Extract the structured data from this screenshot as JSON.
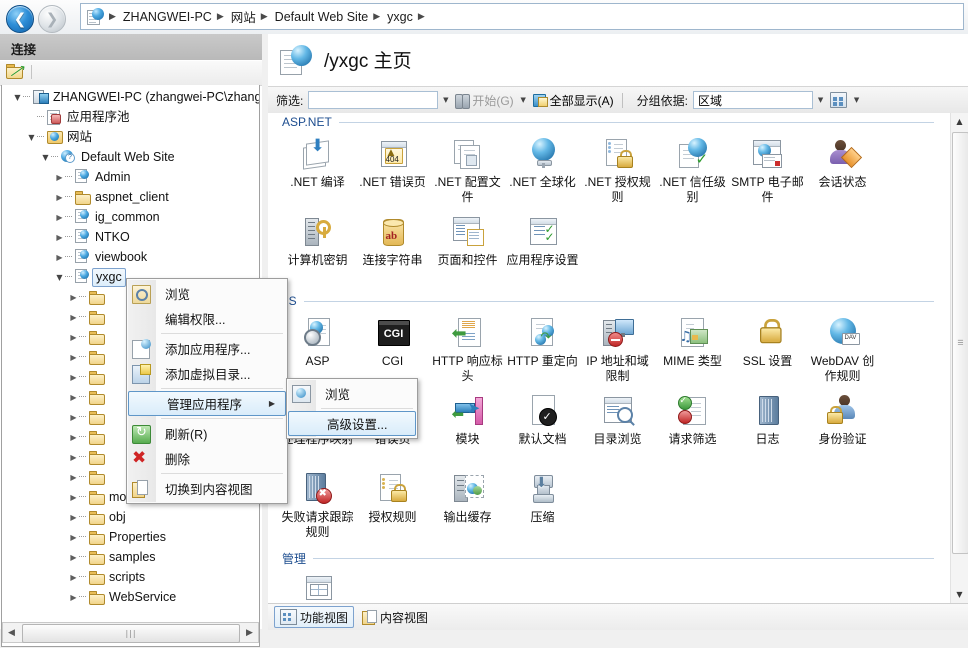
{
  "window": {
    "breadcrumb": [
      "ZHANGWEI-PC",
      "网站",
      "Default Web Site",
      "yxgc"
    ],
    "nav_back_label": "后退",
    "nav_forward_label": "前进"
  },
  "sidebar": {
    "header": "连接",
    "toolbar_icon": "connect-folder-icon",
    "tree": [
      {
        "label": "ZHANGWEI-PC (zhangwei-PC\\zhangw",
        "icon": "server-icon",
        "indent": 0,
        "expander": "open"
      },
      {
        "label": "应用程序池",
        "icon": "app-pool-icon",
        "indent": 1,
        "expander": "none"
      },
      {
        "label": "网站",
        "icon": "sites-folder-icon",
        "indent": 1,
        "expander": "open"
      },
      {
        "label": "Default Web Site",
        "icon": "web-site-icon",
        "indent": 2,
        "expander": "open"
      },
      {
        "label": "Admin",
        "icon": "application-icon",
        "indent": 3,
        "expander": "closed"
      },
      {
        "label": "aspnet_client",
        "icon": "folder-icon",
        "indent": 3,
        "expander": "closed"
      },
      {
        "label": "ig_common",
        "icon": "application-icon",
        "indent": 3,
        "expander": "closed"
      },
      {
        "label": "NTKO",
        "icon": "application-icon",
        "indent": 3,
        "expander": "closed"
      },
      {
        "label": "viewbook",
        "icon": "application-icon",
        "indent": 3,
        "expander": "closed"
      },
      {
        "label": "yxgc",
        "icon": "application-icon",
        "indent": 3,
        "expander": "open",
        "selected": true
      },
      {
        "label": "",
        "icon": "folder-icon",
        "indent": 4,
        "expander": "closed"
      },
      {
        "label": "",
        "icon": "folder-icon",
        "indent": 4,
        "expander": "closed"
      },
      {
        "label": "",
        "icon": "folder-icon",
        "indent": 4,
        "expander": "closed"
      },
      {
        "label": "",
        "icon": "folder-icon",
        "indent": 4,
        "expander": "closed"
      },
      {
        "label": "",
        "icon": "folder-icon",
        "indent": 4,
        "expander": "closed"
      },
      {
        "label": "",
        "icon": "folder-icon",
        "indent": 4,
        "expander": "closed"
      },
      {
        "label": "",
        "icon": "folder-icon",
        "indent": 4,
        "expander": "closed"
      },
      {
        "label": "",
        "icon": "folder-icon",
        "indent": 4,
        "expander": "closed"
      },
      {
        "label": "",
        "icon": "folder-icon",
        "indent": 4,
        "expander": "closed"
      },
      {
        "label": "",
        "icon": "folder-icon",
        "indent": 4,
        "expander": "closed"
      },
      {
        "label": "module",
        "icon": "folder-icon",
        "indent": 4,
        "expander": "closed"
      },
      {
        "label": "obj",
        "icon": "folder-icon",
        "indent": 4,
        "expander": "closed"
      },
      {
        "label": "Properties",
        "icon": "folder-icon",
        "indent": 4,
        "expander": "closed"
      },
      {
        "label": "samples",
        "icon": "folder-icon",
        "indent": 4,
        "expander": "closed"
      },
      {
        "label": "scripts",
        "icon": "folder-icon",
        "indent": 4,
        "expander": "closed"
      },
      {
        "label": "WebService",
        "icon": "folder-icon",
        "indent": 4,
        "expander": "closed"
      }
    ]
  },
  "page": {
    "title": "/yxgc 主页",
    "title_icon": "application-home-icon"
  },
  "filterbar": {
    "filter_label": "筛选:",
    "filter_value": "",
    "filter_placeholder": "",
    "go_label": "开始(G)",
    "show_all_label": "全部显示(A)",
    "group_by_label": "分组依据:",
    "group_by_value": "区域",
    "view_button": "view-options-button"
  },
  "sections": [
    {
      "title": "ASP.NET",
      "items": [
        {
          "label": ".NET 编译",
          "icon": "net-compilation-icon"
        },
        {
          "label": ".NET 错误页",
          "icon": "net-error-pages-icon"
        },
        {
          "label": ".NET 配置文件",
          "icon": "net-profile-icon"
        },
        {
          "label": ".NET 全球化",
          "icon": "net-globalization-icon"
        },
        {
          "label": ".NET 授权规则",
          "icon": "net-authorization-rules-icon"
        },
        {
          "label": ".NET 信任级别",
          "icon": "net-trust-levels-icon"
        },
        {
          "label": "SMTP 电子邮件",
          "icon": "smtp-email-icon"
        },
        {
          "label": "会话状态",
          "icon": "session-state-icon"
        },
        {
          "label": "计算机密钥",
          "icon": "machine-key-icon"
        },
        {
          "label": "连接字符串",
          "icon": "connection-strings-icon"
        },
        {
          "label": "页面和控件",
          "icon": "pages-and-controls-icon"
        },
        {
          "label": "应用程序设置",
          "icon": "application-settings-icon"
        }
      ]
    },
    {
      "title": "IIS",
      "items": [
        {
          "label": "ASP",
          "icon": "asp-icon"
        },
        {
          "label": "CGI",
          "icon": "cgi-icon"
        },
        {
          "label": "HTTP 响应标头",
          "icon": "http-response-headers-icon"
        },
        {
          "label": "HTTP 重定向",
          "icon": "http-redirect-icon"
        },
        {
          "label": "IP 地址和域限制",
          "icon": "ip-address-domain-restrictions-icon"
        },
        {
          "label": "MIME 类型",
          "icon": "mime-types-icon"
        },
        {
          "label": "SSL 设置",
          "icon": "ssl-settings-icon"
        },
        {
          "label": "WebDAV 创作规则",
          "icon": "webdav-authoring-rules-icon"
        },
        {
          "label": "处理程序映射",
          "icon": "handler-mappings-icon"
        },
        {
          "label": "错误页",
          "icon": "error-pages-icon"
        },
        {
          "label": "模块",
          "icon": "modules-icon"
        },
        {
          "label": "默认文档",
          "icon": "default-document-icon"
        },
        {
          "label": "目录浏览",
          "icon": "directory-browsing-icon"
        },
        {
          "label": "请求筛选",
          "icon": "request-filtering-icon"
        },
        {
          "label": "日志",
          "icon": "logging-icon"
        },
        {
          "label": "身份验证",
          "icon": "authentication-icon"
        },
        {
          "label": "失败请求跟踪规则",
          "icon": "failed-request-tracing-rules-icon"
        },
        {
          "label": "授权规则",
          "icon": "authorization-rules-icon"
        },
        {
          "label": "输出缓存",
          "icon": "output-caching-icon"
        },
        {
          "label": "压缩",
          "icon": "compression-icon"
        }
      ]
    },
    {
      "title": "管理",
      "items": [
        {
          "label": "",
          "icon": "configuration-editor-icon"
        }
      ]
    }
  ],
  "context_menu": {
    "items": [
      {
        "label": "浏览",
        "icon": "browse-icon",
        "separator_after": false
      },
      {
        "label": "编辑权限...",
        "icon": "none",
        "separator_after": true
      },
      {
        "label": "添加应用程序...",
        "icon": "add-application-icon",
        "separator_after": false
      },
      {
        "label": "添加虚拟目录...",
        "icon": "add-virtual-directory-icon",
        "separator_after": true
      },
      {
        "label": "管理应用程序",
        "icon": "none",
        "submenu": true,
        "highlighted": true,
        "separator_after": true
      },
      {
        "label": "刷新(R)",
        "icon": "refresh-icon",
        "separator_after": false
      },
      {
        "label": "删除",
        "icon": "delete-icon",
        "separator_after": true
      },
      {
        "label": "切换到内容视图",
        "icon": "switch-content-view-icon",
        "separator_after": false
      }
    ]
  },
  "submenu": {
    "items": [
      {
        "label": "浏览",
        "icon": "browse-globe-icon",
        "separator_after": true,
        "highlighted": false
      },
      {
        "label": "高级设置...",
        "icon": "none",
        "separator_after": false,
        "highlighted": true
      }
    ]
  },
  "bottom_tabs": [
    {
      "label": "功能视图",
      "icon": "features-view-icon",
      "active": true
    },
    {
      "label": "内容视图",
      "icon": "content-view-icon",
      "active": false
    }
  ],
  "scrollbars": {
    "vertical_up": "▲",
    "vertical_down": "▼",
    "horizontal_left": "◀",
    "horizontal_right": "▶"
  },
  "colors": {
    "section_title": "#1d4d8f",
    "selection_border": "#5f96c8",
    "selection_fill": "#ddeefb"
  }
}
